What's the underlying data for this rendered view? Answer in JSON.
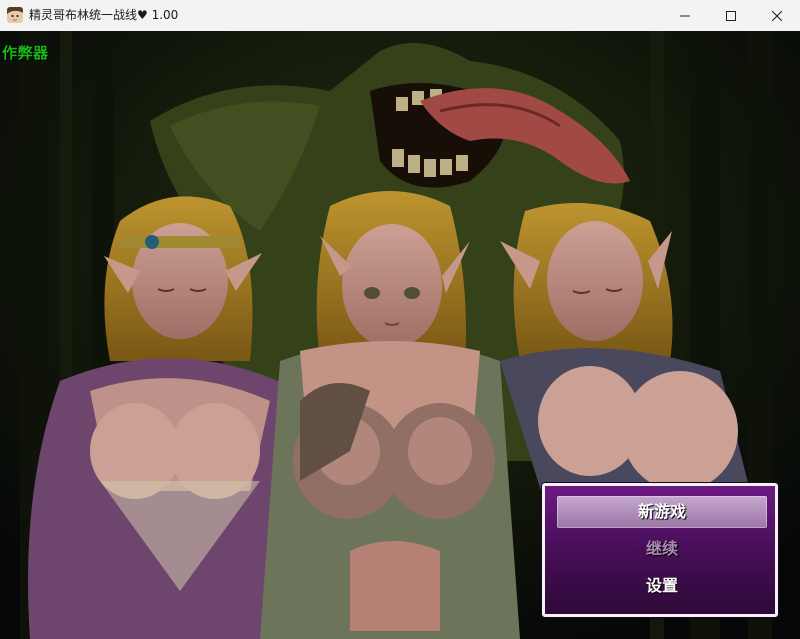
{
  "window": {
    "title": "精灵哥布林统一战线♥ 1.00",
    "icon": "portrait-app-icon",
    "controls": [
      "minimize-icon",
      "maximize-icon",
      "close-icon"
    ]
  },
  "game": {
    "cheat_label": "作弊器",
    "menu": {
      "items": [
        {
          "label": "新游戏",
          "state": "selected"
        },
        {
          "label": "继续",
          "state": "disabled"
        },
        {
          "label": "设置",
          "state": "normal"
        }
      ]
    }
  },
  "colors": {
    "cheat_text": "#18b818",
    "menu_background": "#4a0f5c",
    "menu_border": "#f4f1f7",
    "disabled_text": "#a98ab3"
  }
}
